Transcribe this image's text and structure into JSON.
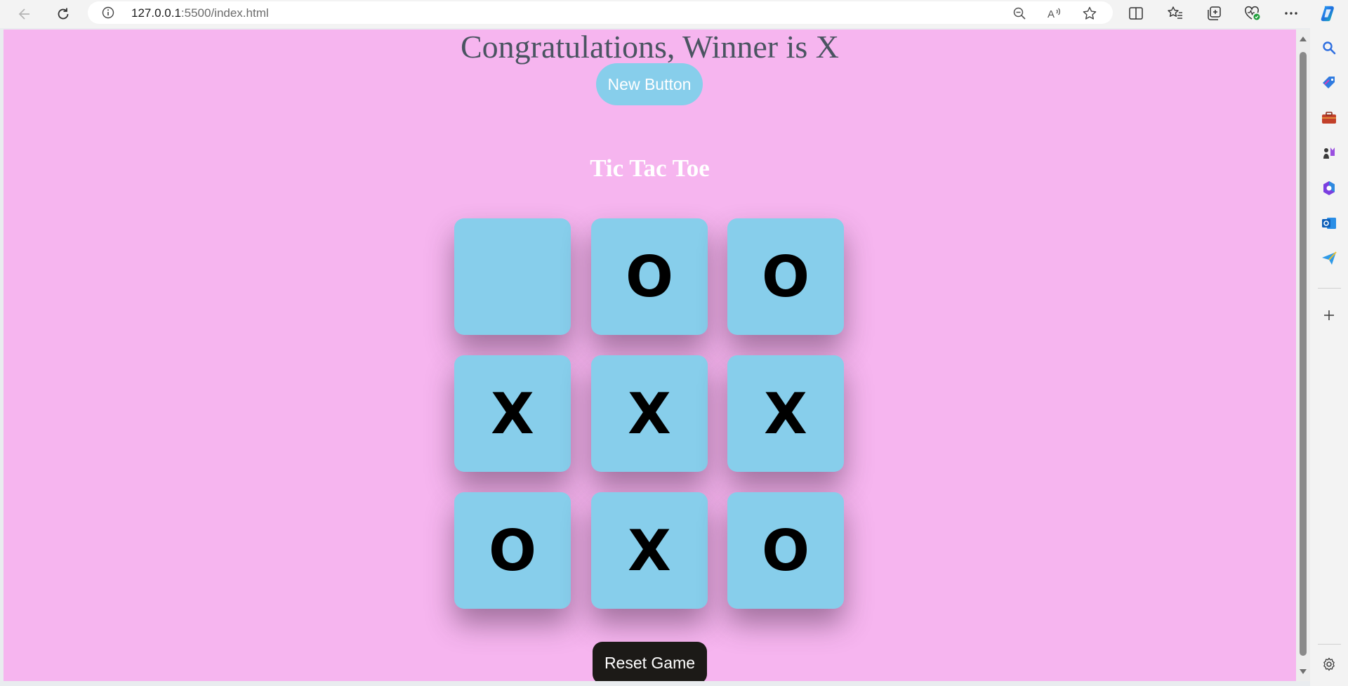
{
  "browser": {
    "url_host": "127.0.0.1",
    "url_path": ":5500/index.html"
  },
  "page": {
    "winner_text": "Congratulations, Winner is X",
    "new_button_label": "New Button",
    "title": "Tic Tac Toe",
    "board": [
      "",
      "O",
      "O",
      "X",
      "X",
      "X",
      "O",
      "X",
      "O"
    ],
    "reset_button_label": "Reset Game"
  },
  "colors": {
    "page_background": "#f6b5ef",
    "cell": "#87ceeb",
    "new_button": "#87ceeb",
    "reset_button": "#1c1a17",
    "winner_text": "#4a5461"
  },
  "icons": {
    "toolbar": [
      "back-icon",
      "refresh-icon",
      "info-icon",
      "zoom-out-icon",
      "read-aloud-icon",
      "favorite-star-icon",
      "split-screen-icon",
      "favorites-icon",
      "collections-icon",
      "browser-essentials-icon",
      "more-icon",
      "copilot-icon"
    ],
    "sidebar": [
      "search-icon",
      "shopping-icon",
      "tools-icon",
      "games-icon",
      "office-icon",
      "outlook-icon",
      "send-icon",
      "add-icon",
      "settings-icon"
    ]
  }
}
